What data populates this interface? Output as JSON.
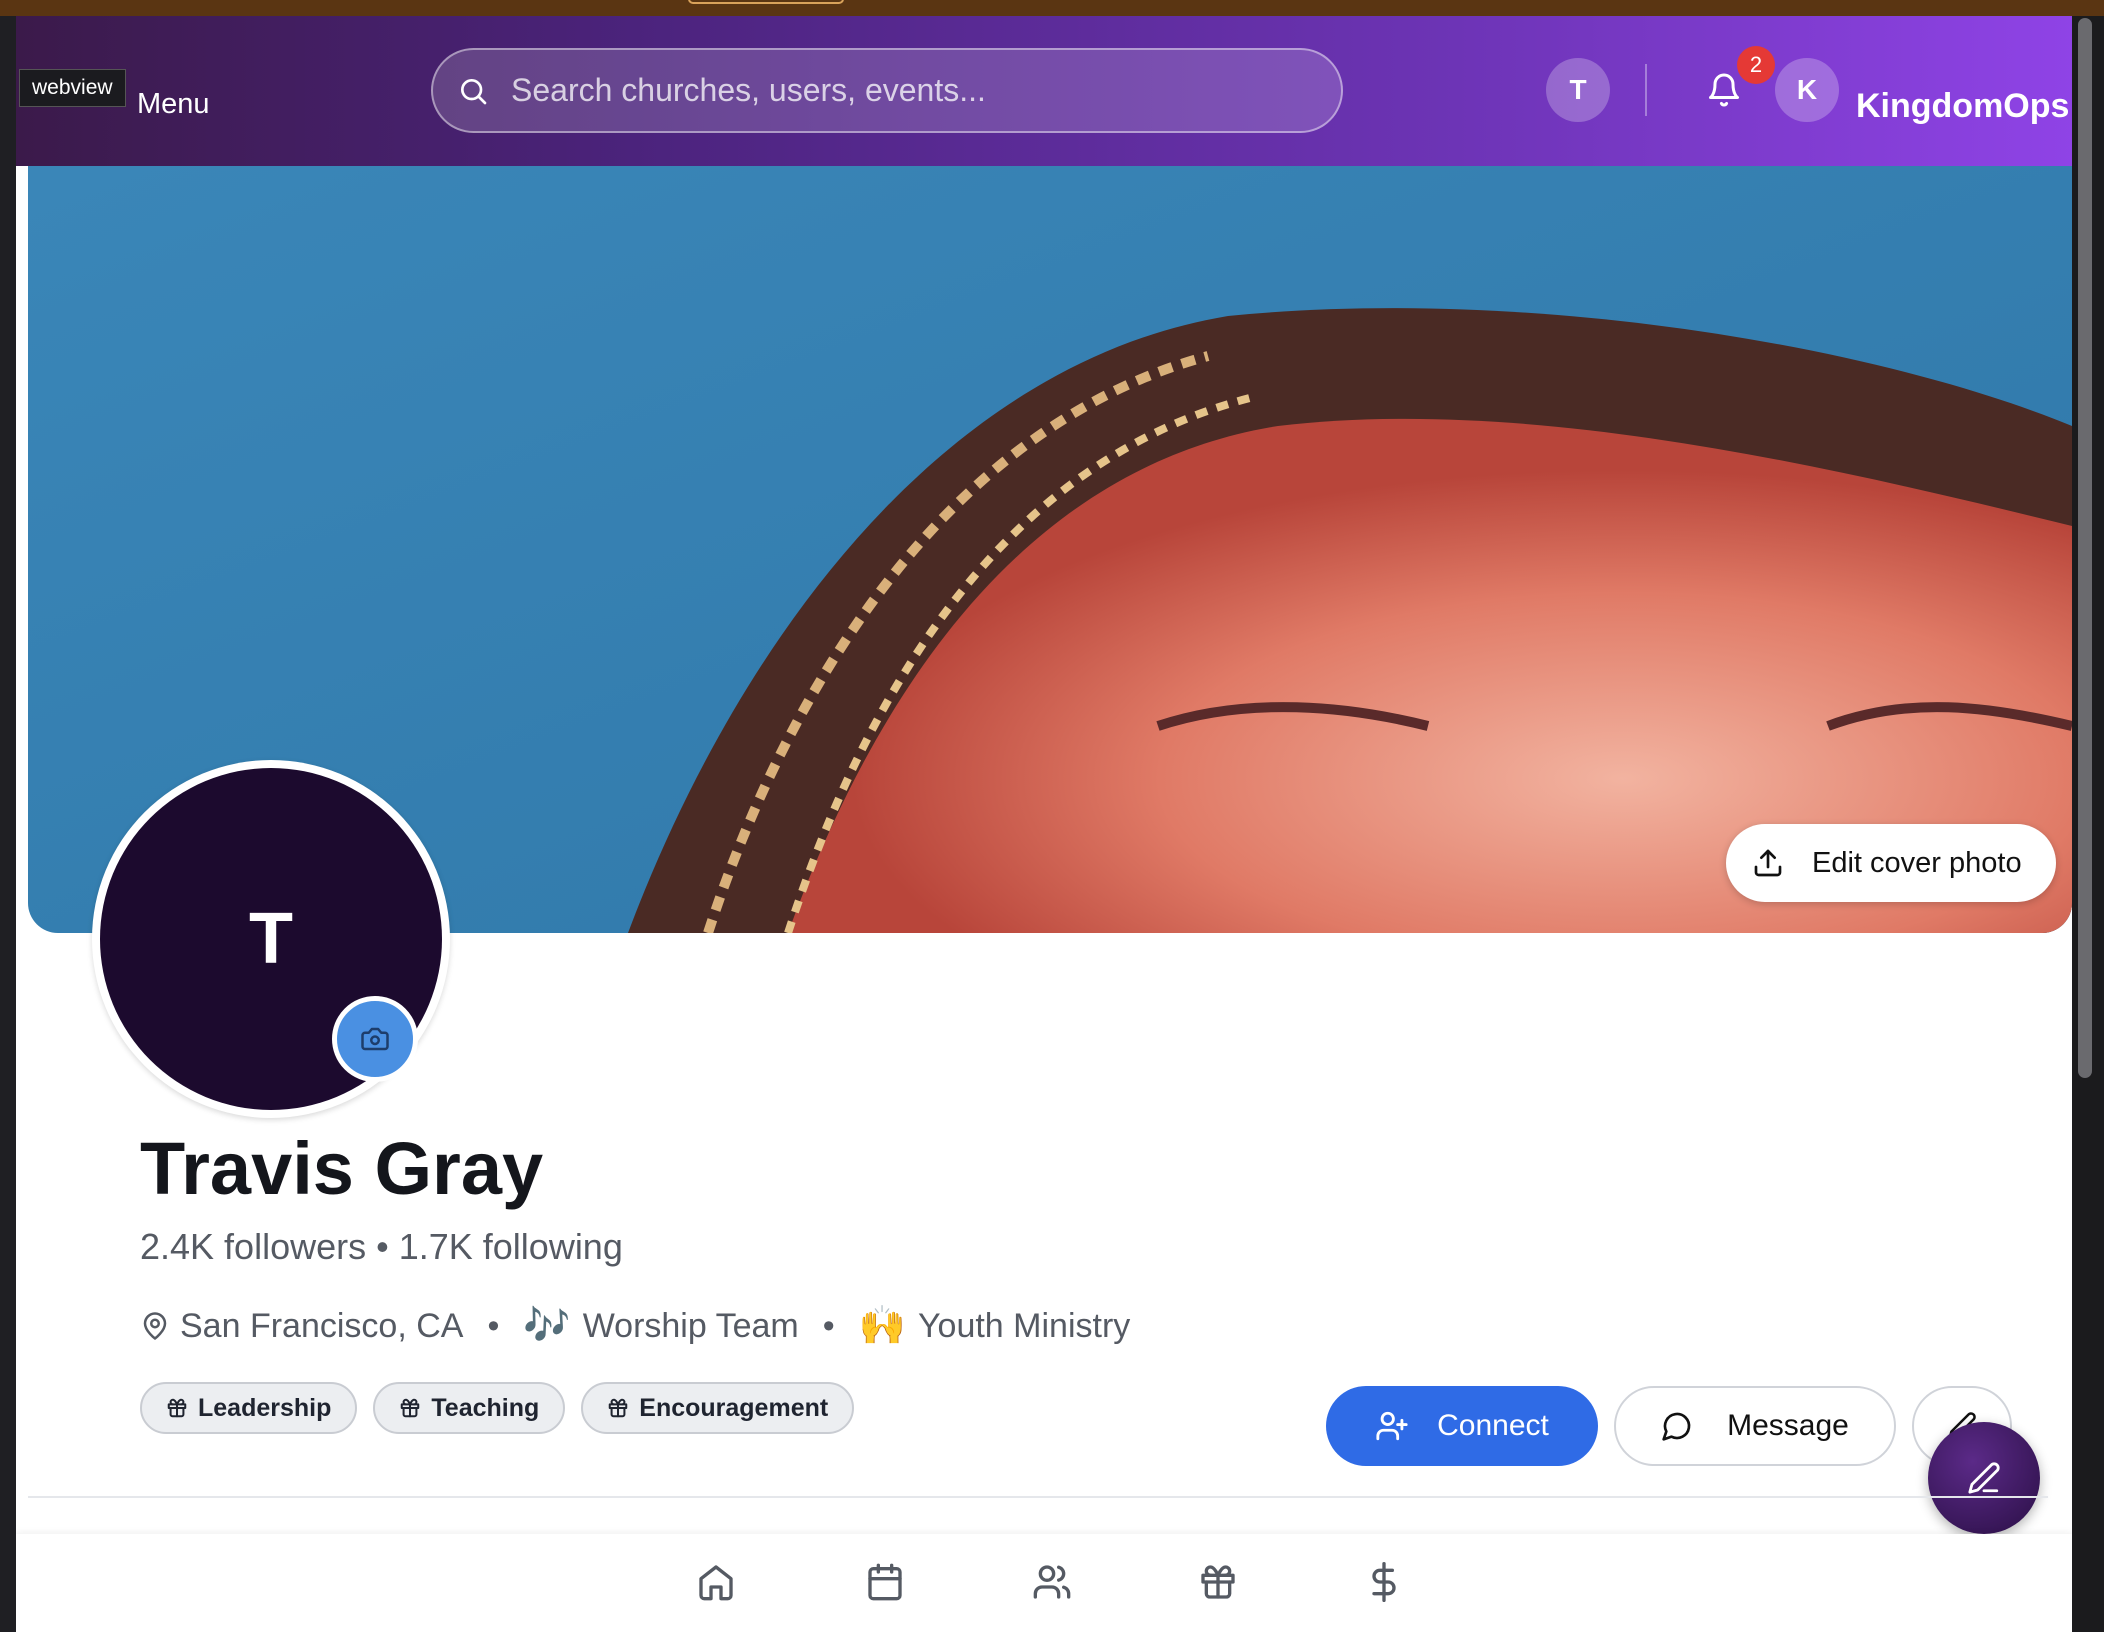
{
  "header": {
    "webview_tag": "webview",
    "menu_label": "Menu",
    "search_placeholder": "Search churches, users, events...",
    "user_initial": "T",
    "notification_count": "2",
    "account_initial": "K",
    "brand": "KingdomOps"
  },
  "cover": {
    "edit_label": "Edit cover photo"
  },
  "profile": {
    "initial": "T",
    "name": "Travis Gray",
    "stats": "2.4K followers • 1.7K following",
    "location": "San Francisco, CA",
    "ministries": [
      {
        "emoji": "🎶",
        "label": "Worship Team"
      },
      {
        "emoji": "🙌",
        "label": "Youth Ministry"
      }
    ],
    "gifts": [
      "Leadership",
      "Teaching",
      "Encouragement"
    ]
  },
  "actions": {
    "connect_label": "Connect",
    "message_label": "Message"
  },
  "bottom_nav": {
    "items": [
      "home-icon",
      "calendar-icon",
      "users-icon",
      "gift-icon",
      "dollar-icon"
    ]
  },
  "colors": {
    "header_start": "#3b1a4a",
    "header_end": "#8f43e6",
    "connect_blue": "#2f6be6",
    "badge_red": "#e53935",
    "avatar_bg": "#1c0a2e"
  }
}
